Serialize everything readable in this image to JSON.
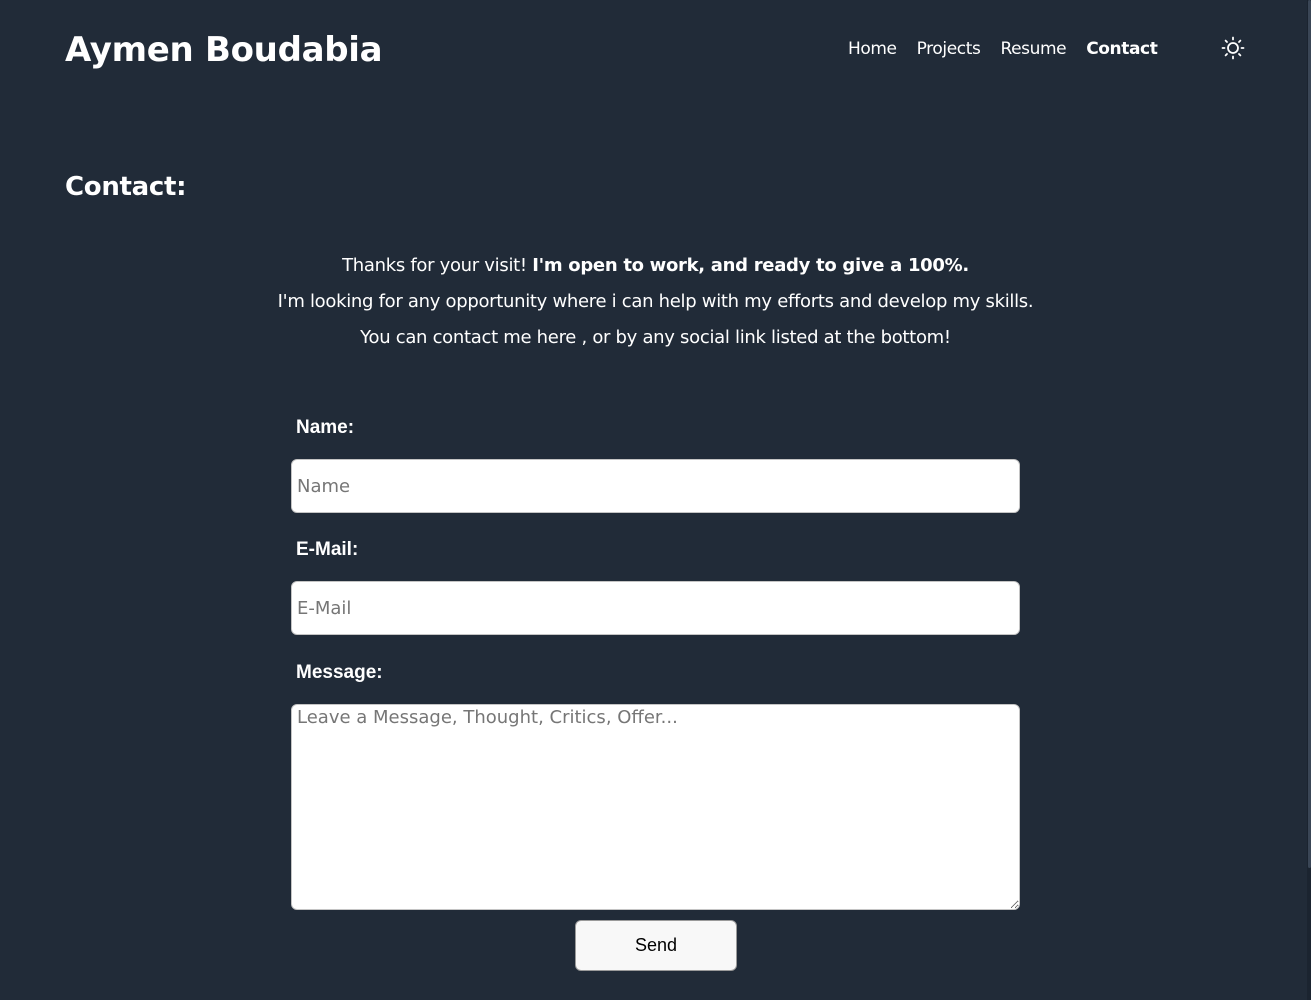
{
  "header": {
    "site_title": "Aymen Boudabia",
    "nav": [
      {
        "label": "Home",
        "active": false
      },
      {
        "label": "Projects",
        "active": false
      },
      {
        "label": "Resume",
        "active": false
      },
      {
        "label": "Contact",
        "active": true
      }
    ],
    "theme_icon": "sun-icon"
  },
  "page": {
    "title": "Contact:",
    "intro": {
      "line1_plain": "Thanks for your visit! ",
      "line1_bold": "I'm open to work, and ready to give a 100%.",
      "line2": "I'm looking for any opportunity where i can help with my efforts and develop my skills.",
      "line3": "You can contact me here , or by any social link listed at the bottom!"
    }
  },
  "form": {
    "name_label": "Name:",
    "name_placeholder": "Name",
    "email_label": "E-Mail:",
    "email_placeholder": "E-Mail",
    "message_label": "Message:",
    "message_placeholder": "Leave a Message, Thought, Critics, Offer...",
    "send_label": "Send"
  },
  "colors": {
    "background": "#212b38",
    "text": "#ffffff",
    "button_bg": "#f8f8f8"
  }
}
